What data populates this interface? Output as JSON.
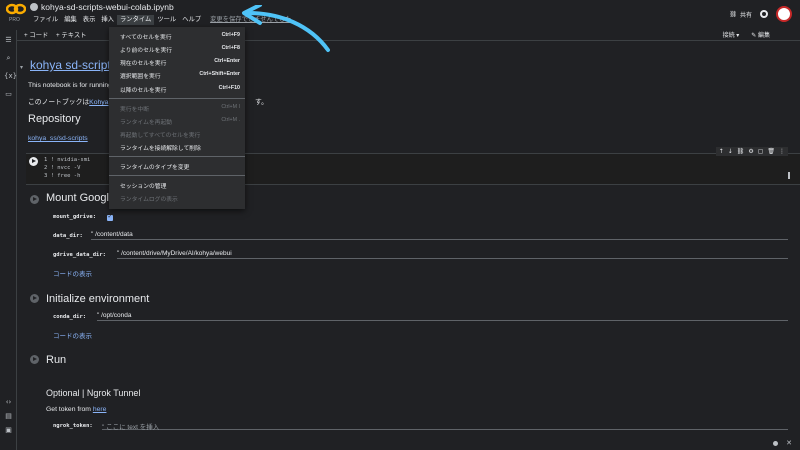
{
  "app": {
    "logo_badge": "PRO",
    "file_name": "kohya-sd-scripts-webui-colab.ipynb"
  },
  "menubar": {
    "items": [
      "ファイル",
      "編集",
      "表示",
      "挿入",
      "ランタイム",
      "ツール",
      "ヘルプ"
    ],
    "save_note": "変更を保存できませんでした"
  },
  "topright": {
    "share_label": "共有"
  },
  "toolbar": {
    "add_code": "+ コード",
    "add_text": "+ テキスト",
    "connect": "接続 ▾",
    "edit": "✎ 編集"
  },
  "runtime_menu": {
    "items": [
      {
        "label": "すべてのセルを実行",
        "shortcut": "Ctrl+F9",
        "disabled": false
      },
      {
        "label": "より前のセルを実行",
        "shortcut": "Ctrl+F8",
        "disabled": false
      },
      {
        "label": "現在のセルを実行",
        "shortcut": "Ctrl+Enter",
        "disabled": false
      },
      {
        "label": "選択範囲を実行",
        "shortcut": "Ctrl+Shift+Enter",
        "disabled": false
      },
      {
        "label": "以降のセルを実行",
        "shortcut": "Ctrl+F10",
        "disabled": false
      },
      {
        "label": "実行を中断",
        "shortcut": "Ctrl+M I",
        "disabled": true
      },
      {
        "label": "ランタイムを再起動",
        "shortcut": "Ctrl+M .",
        "disabled": true
      },
      {
        "label": "再起動してすべてのセルを実行",
        "shortcut": "",
        "disabled": true
      },
      {
        "label": "ランタイムを接続解除して削除",
        "shortcut": "",
        "disabled": false
      },
      {
        "label": "ランタイムのタイプを変更",
        "shortcut": "",
        "disabled": false
      },
      {
        "label": "セッションの管理",
        "shortcut": "",
        "disabled": false
      },
      {
        "label": "ランタイムログの表示",
        "shortcut": "",
        "disabled": true
      }
    ]
  },
  "notebook": {
    "title": "kohya sd-scripts",
    "intro_en": "This notebook is for running",
    "intro_ja_prefix": "このノートブックは",
    "intro_ja_link": "Kohya",
    "intro_ja_suffix": "す。",
    "repo_heading": "Repository",
    "repo_link": "kohya_ss/sd-scripts",
    "code_lines": [
      "1 ! nvidia-smi",
      "2 ! nvcc -V",
      "3 ! free -h"
    ],
    "mount_heading": "Mount Googl",
    "mount_gdrive_label": "mount_gdrive:",
    "data_dir_label": "data_dir:",
    "data_dir_value": "\" /content/data",
    "gdrive_data_dir_label": "gdrive_data_dir:",
    "gdrive_data_dir_value": "\" /content/drive/MyDrive/AI/kohya/webui",
    "show_code_1": "コードの表示",
    "init_heading": "Initialize environment",
    "conda_dir_label": "conda_dir:",
    "conda_dir_value": "\" /opt/conda",
    "show_code_2": "コードの表示",
    "run_heading": "Run",
    "ngrok_heading": "Optional | Ngrok Tunnel",
    "token_text": "Get token from ",
    "token_link": "here",
    "ngrok_token_label": "ngrok_token:",
    "ngrok_token_placeholder": "\" ここに text を挿入"
  }
}
